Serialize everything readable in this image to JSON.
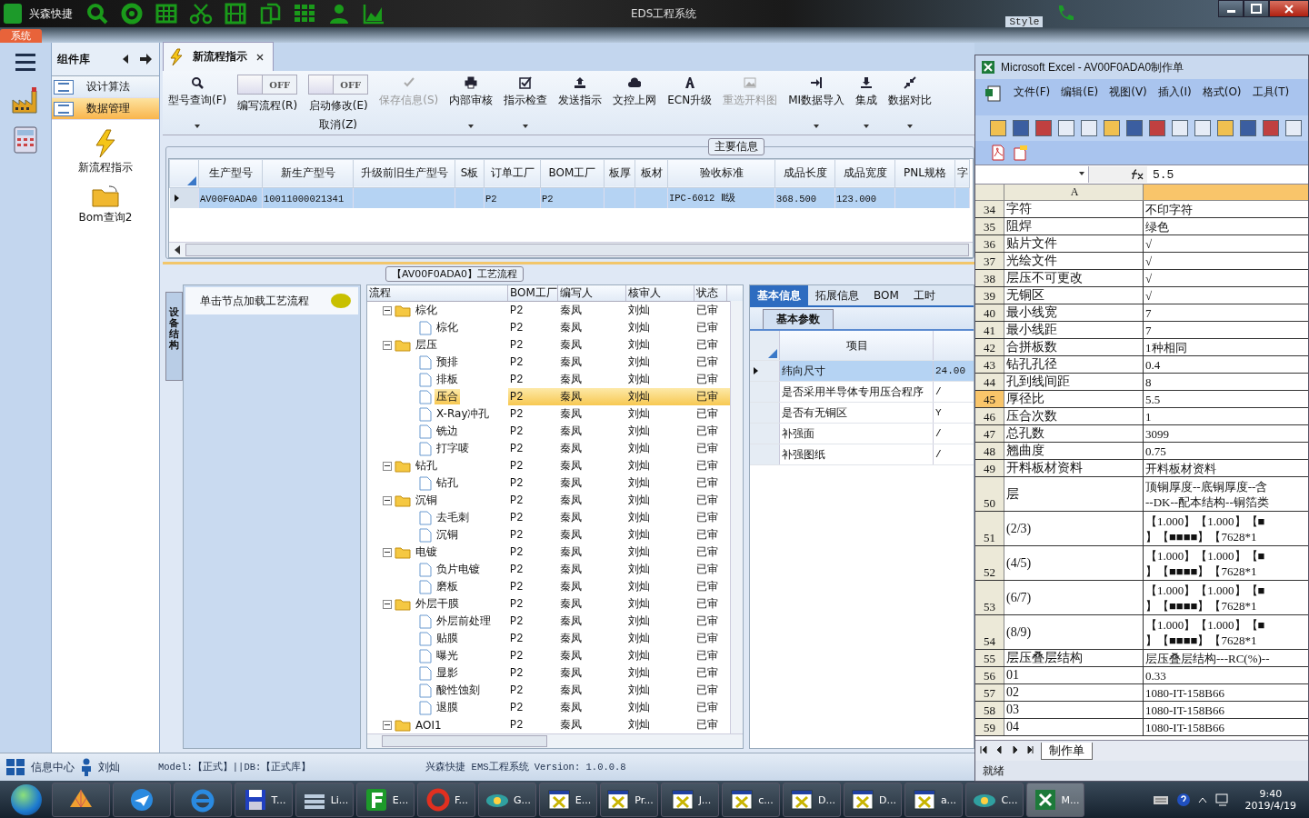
{
  "title_bar": {
    "app": "兴森快捷",
    "title": "EDS工程系统",
    "style_label": "Style"
  },
  "ribbon_tab": {
    "label": "系统"
  },
  "component_panel": {
    "title": "组件库",
    "items": [
      {
        "label": "设计算法",
        "selected": false
      },
      {
        "label": "数据管理",
        "selected": true
      }
    ],
    "tools": [
      {
        "label": "新流程指示",
        "kind": "bolt"
      },
      {
        "label": "Bom查询2",
        "kind": "folder"
      }
    ]
  },
  "doc_tab": {
    "label": "新流程指示"
  },
  "toolbar": [
    {
      "kind": "button",
      "label": "型号查询(F)",
      "dropdown": true,
      "disabled": false
    },
    {
      "kind": "toggle",
      "toggle": "OFF",
      "on": false,
      "label": "编写流程(R)"
    },
    {
      "kind": "toggle",
      "toggle": "OFF",
      "on": false,
      "label": "启动修改(E)",
      "label2": "取消(Z)"
    },
    {
      "kind": "button",
      "label": "保存信息(S)",
      "dropdown": false,
      "disabled": true
    },
    {
      "kind": "button",
      "label": "内部审核",
      "dropdown": true,
      "disabled": false
    },
    {
      "kind": "button",
      "label": "指示检查",
      "dropdown": true,
      "disabled": false
    },
    {
      "kind": "button",
      "label": "发送指示",
      "dropdown": false,
      "disabled": false
    },
    {
      "kind": "button",
      "label": "文控上网",
      "dropdown": false,
      "disabled": false
    },
    {
      "kind": "button",
      "label": "ECN升级",
      "dropdown": false,
      "disabled": false
    },
    {
      "kind": "button",
      "label": "重选开料图",
      "dropdown": false,
      "disabled": true
    },
    {
      "kind": "button",
      "label": "MI数据导入",
      "dropdown": true,
      "disabled": false
    },
    {
      "kind": "button",
      "label": "集成",
      "dropdown": true,
      "disabled": false
    },
    {
      "kind": "button",
      "label": "数据对比",
      "dropdown": true,
      "disabled": false
    }
  ],
  "main_info": {
    "legend": "主要信息",
    "columns": [
      "生产型号",
      "新生产型号",
      "升级前旧生产型号",
      "S板",
      "订单工厂",
      "BOM工厂",
      "板厚",
      "板材",
      "验收标准",
      "成品长度",
      "成品宽度",
      "PNL规格",
      "字"
    ],
    "rows": [
      {
        "selected": true,
        "cells": [
          "AV00F0ADA0",
          "10011000021341",
          null,
          null,
          "P2",
          "P2",
          null,
          null,
          "IPC-6012 Ⅱ级",
          "368.500",
          "123.000",
          null,
          null
        ]
      }
    ]
  },
  "process": {
    "title": "【AV00F0ADA0】工艺流程",
    "side_tab": "设备结构",
    "hint": "单击节点加载工艺流程",
    "columns": [
      "流程",
      "BOM工厂",
      "编写人",
      "核审人",
      "状态"
    ],
    "nodes": [
      {
        "name": "棕化",
        "bom": "P2",
        "writer": "秦凤",
        "reviewer": "刘灿",
        "status": "已审",
        "selected": false,
        "expanded": true,
        "children": [
          {
            "name": "棕化",
            "bom": "P2",
            "writer": "秦凤",
            "reviewer": "刘灿",
            "status": "已审",
            "selected": false
          }
        ]
      },
      {
        "name": "层压",
        "bom": "P2",
        "writer": "秦凤",
        "reviewer": "刘灿",
        "status": "已审",
        "selected": false,
        "expanded": true,
        "children": [
          {
            "name": "预排",
            "bom": "P2",
            "writer": "秦凤",
            "reviewer": "刘灿",
            "status": "已审",
            "selected": false
          },
          {
            "name": "排板",
            "bom": "P2",
            "writer": "秦凤",
            "reviewer": "刘灿",
            "status": "已审",
            "selected": false
          },
          {
            "name": "压合",
            "bom": "P2",
            "writer": "秦凤",
            "reviewer": "刘灿",
            "status": "已审",
            "selected": true
          },
          {
            "name": "X-Ray冲孔",
            "bom": "P2",
            "writer": "秦凤",
            "reviewer": "刘灿",
            "status": "已审",
            "selected": false
          },
          {
            "name": "铣边",
            "bom": "P2",
            "writer": "秦凤",
            "reviewer": "刘灿",
            "status": "已审",
            "selected": false
          },
          {
            "name": "打字唛",
            "bom": "P2",
            "writer": "秦凤",
            "reviewer": "刘灿",
            "status": "已审",
            "selected": false
          }
        ]
      },
      {
        "name": "钻孔",
        "bom": "P2",
        "writer": "秦凤",
        "reviewer": "刘灿",
        "status": "已审",
        "selected": false,
        "expanded": true,
        "children": [
          {
            "name": "钻孔",
            "bom": "P2",
            "writer": "秦凤",
            "reviewer": "刘灿",
            "status": "已审",
            "selected": false
          }
        ]
      },
      {
        "name": "沉铜",
        "bom": "P2",
        "writer": "秦凤",
        "reviewer": "刘灿",
        "status": "已审",
        "selected": false,
        "expanded": true,
        "children": [
          {
            "name": "去毛刺",
            "bom": "P2",
            "writer": "秦凤",
            "reviewer": "刘灿",
            "status": "已审",
            "selected": false
          },
          {
            "name": "沉铜",
            "bom": "P2",
            "writer": "秦凤",
            "reviewer": "刘灿",
            "status": "已审",
            "selected": false
          }
        ]
      },
      {
        "name": "电镀",
        "bom": "P2",
        "writer": "秦凤",
        "reviewer": "刘灿",
        "status": "已审",
        "selected": false,
        "expanded": true,
        "children": [
          {
            "name": "负片电镀",
            "bom": "P2",
            "writer": "秦凤",
            "reviewer": "刘灿",
            "status": "已审",
            "selected": false
          },
          {
            "name": "磨板",
            "bom": "P2",
            "writer": "秦凤",
            "reviewer": "刘灿",
            "status": "已审",
            "selected": false
          }
        ]
      },
      {
        "name": "外层干膜",
        "bom": "P2",
        "writer": "秦凤",
        "reviewer": "刘灿",
        "status": "已审",
        "selected": false,
        "expanded": true,
        "children": [
          {
            "name": "外层前处理",
            "bom": "P2",
            "writer": "秦凤",
            "reviewer": "刘灿",
            "status": "已审",
            "selected": false
          },
          {
            "name": "贴膜",
            "bom": "P2",
            "writer": "秦凤",
            "reviewer": "刘灿",
            "status": "已审",
            "selected": false
          },
          {
            "name": "曝光",
            "bom": "P2",
            "writer": "秦凤",
            "reviewer": "刘灿",
            "status": "已审",
            "selected": false
          },
          {
            "name": "显影",
            "bom": "P2",
            "writer": "秦凤",
            "reviewer": "刘灿",
            "status": "已审",
            "selected": false
          },
          {
            "name": "酸性蚀刻",
            "bom": "P2",
            "writer": "秦凤",
            "reviewer": "刘灿",
            "status": "已审",
            "selected": false
          },
          {
            "name": "退膜",
            "bom": "P2",
            "writer": "秦凤",
            "reviewer": "刘灿",
            "status": "已审",
            "selected": false
          }
        ]
      },
      {
        "name": "AOI1",
        "bom": "P2",
        "writer": "秦凤",
        "reviewer": "刘灿",
        "status": "已审",
        "selected": false,
        "expanded": true
      }
    ]
  },
  "detail": {
    "tabs": [
      {
        "label": "基本信息",
        "selected": true
      },
      {
        "label": "拓展信息",
        "selected": false
      },
      {
        "label": "BOM",
        "selected": false
      },
      {
        "label": "工时",
        "selected": false
      }
    ],
    "subtab": "基本参数",
    "column": "项目",
    "rows": [
      {
        "item": "纬向尺寸",
        "value": "24.00",
        "selected": true
      },
      {
        "item": "是否采用半导体专用压合程序",
        "value": "/",
        "selected": false
      },
      {
        "item": "是否有无铜区",
        "value": "Y",
        "selected": false
      },
      {
        "item": "补强面",
        "value": "/",
        "selected": false
      },
      {
        "item": "补强图纸",
        "value": "/",
        "selected": false
      }
    ]
  },
  "status_bar": {
    "info": "信息中心",
    "user": "刘灿",
    "model": "Model:【正式】||DB:【正式库】",
    "product": "兴森快捷 EMS工程系统 Version: 1.0.0.8"
  },
  "excel": {
    "title": "Microsoft Excel - AV00F0ADA0制作单",
    "menu": [
      "文件(F)",
      "编辑(E)",
      "视图(V)",
      "插入(I)",
      "格式(O)",
      "工具(T)"
    ],
    "formula": "5.5",
    "column_header": "A",
    "rows": [
      {
        "num": "34",
        "a": "字符",
        "b": [
          "不印字符"
        ],
        "selected": false
      },
      {
        "num": "35",
        "a": "阻焊",
        "b": [
          "绿色"
        ],
        "selected": false
      },
      {
        "num": "36",
        "a": "贴片文件",
        "b": [
          "√"
        ],
        "selected": false
      },
      {
        "num": "37",
        "a": "光绘文件",
        "b": [
          "√"
        ],
        "selected": false
      },
      {
        "num": "38",
        "a": "层压不可更改",
        "b": [
          "√"
        ],
        "selected": false
      },
      {
        "num": "39",
        "a": "无铜区",
        "b": [
          "√"
        ],
        "selected": false
      },
      {
        "num": "40",
        "a": "最小线宽",
        "b": [
          "7"
        ],
        "selected": false
      },
      {
        "num": "41",
        "a": "最小线距",
        "b": [
          "7"
        ],
        "selected": false
      },
      {
        "num": "42",
        "a": "合拼板数",
        "b": [
          "1种相同"
        ],
        "selected": false
      },
      {
        "num": "43",
        "a": "钻孔孔径",
        "b": [
          "0.4"
        ],
        "selected": false
      },
      {
        "num": "44",
        "a": "孔到线间距",
        "b": [
          "8"
        ],
        "selected": false
      },
      {
        "num": "45",
        "a": "厚径比",
        "b": [
          "5.5"
        ],
        "selected": true
      },
      {
        "num": "46",
        "a": "压合次数",
        "b": [
          "1"
        ],
        "selected": false
      },
      {
        "num": "47",
        "a": "总孔数",
        "b": [
          "3099"
        ],
        "selected": false
      },
      {
        "num": "48",
        "a": "翘曲度",
        "b": [
          "0.75"
        ],
        "selected": false
      },
      {
        "num": "49",
        "a": "开料板材资料",
        "b": [
          "开料板材资料"
        ],
        "selected": false
      },
      {
        "num": "50",
        "a": "层",
        "b": [
          "顶铜厚度--底铜厚度--含",
          "--DK--配本结构--铜箔类"
        ],
        "selected": false
      },
      {
        "num": "51",
        "a": "(2/3)",
        "b": [
          "【1.000】【1.000】【■",
          "】【■■■■】【7628*1"
        ],
        "selected": false
      },
      {
        "num": "52",
        "a": "(4/5)",
        "b": [
          "【1.000】【1.000】【■",
          "】【■■■■】【7628*1"
        ],
        "selected": false
      },
      {
        "num": "53",
        "a": "(6/7)",
        "b": [
          "【1.000】【1.000】【■",
          "】【■■■■】【7628*1"
        ],
        "selected": false
      },
      {
        "num": "54",
        "a": "(8/9)",
        "b": [
          "【1.000】【1.000】【■",
          "】【■■■■】【7628*1"
        ],
        "selected": false
      },
      {
        "num": "55",
        "a": "层压叠层结构",
        "b": [
          "层压叠层结构---RC(%)--"
        ],
        "selected": false
      },
      {
        "num": "56",
        "a": "01",
        "b": [
          "0.33"
        ],
        "selected": false
      },
      {
        "num": "57",
        "a": "02",
        "b": [
          "1080-IT-158B66"
        ],
        "selected": false
      },
      {
        "num": "58",
        "a": "03",
        "b": [
          "1080-IT-158B66"
        ],
        "selected": false
      },
      {
        "num": "59",
        "a": "04",
        "b": [
          "1080-IT-158B66"
        ],
        "selected": false
      }
    ],
    "sheet_tab": "制作单",
    "status": "就绪"
  },
  "taskbar": {
    "items": [
      {
        "selected": false
      },
      {
        "selected": false
      },
      {
        "selected": false
      },
      {
        "label": "T...",
        "selected": false
      },
      {
        "label": "Li...",
        "selected": false
      },
      {
        "label": "E...",
        "selected": false
      },
      {
        "label": "F...",
        "selected": false
      },
      {
        "label": "G...",
        "selected": false
      },
      {
        "label": "E...",
        "selected": false
      },
      {
        "label": "Pr...",
        "selected": false
      },
      {
        "label": "J...",
        "selected": false
      },
      {
        "label": "c...",
        "selected": false
      },
      {
        "label": "D...",
        "selected": false
      },
      {
        "label": "D...",
        "selected": false
      },
      {
        "label": "a...",
        "selected": false
      },
      {
        "label": "C...",
        "selected": false
      },
      {
        "label": "M...",
        "selected": true
      }
    ],
    "time": "9:40",
    "date": "2019/4/19"
  }
}
